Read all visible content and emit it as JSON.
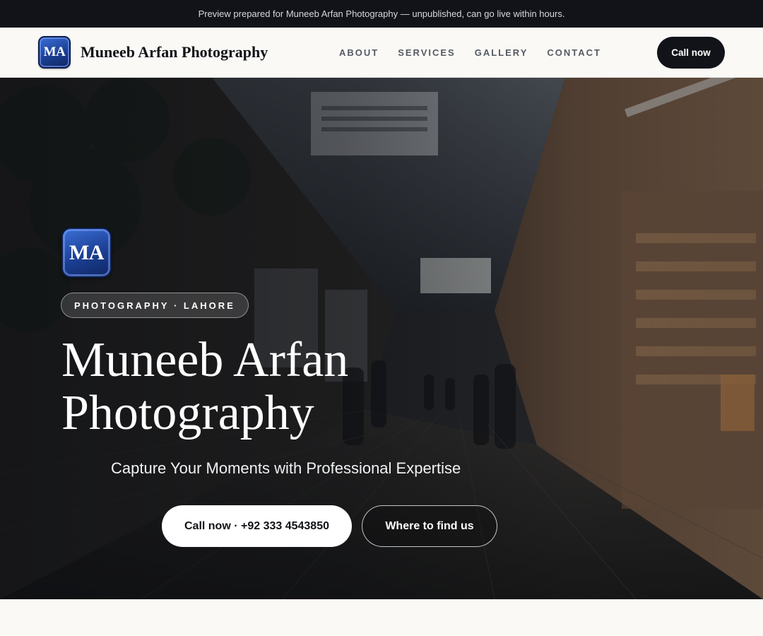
{
  "announcement": "Preview prepared for Muneeb Arfan Photography — unpublished, can go live within hours.",
  "brand": {
    "logo_text": "MA",
    "name": "Muneeb Arfan Photography"
  },
  "nav": {
    "links": [
      "ABOUT",
      "SERVICES",
      "GALLERY",
      "CONTACT"
    ],
    "cta": "Call now"
  },
  "hero": {
    "logo_text": "MA",
    "eyebrow": "PHOTOGRAPHY · LAHORE",
    "title_line1": "Muneeb Arfan",
    "title_line2": "Photography",
    "tagline": "Capture Your Moments with Professional Expertise",
    "primary_cta": "Call now · +92 333 4543850",
    "secondary_cta": "Where to find us",
    "background_image": "market-alley-photo"
  },
  "colors": {
    "dark": "#111318",
    "cream": "#faf9f6",
    "logo_blue": "#1c3f94"
  }
}
